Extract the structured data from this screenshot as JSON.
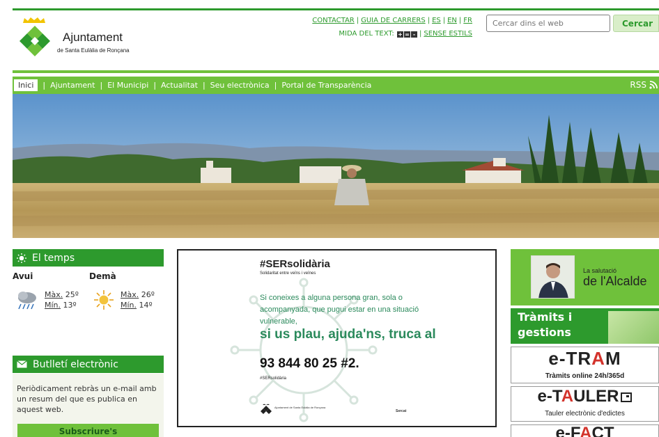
{
  "colors": {
    "brand_green": "#2d9a2d",
    "light_green": "#6fc13b",
    "red": "#d3332c"
  },
  "logo": {
    "title": "Ajuntament",
    "subtitle": "de Santa Eulàlia de Ronçana"
  },
  "toplinks": {
    "contactar": "CONTACTAR",
    "guia": "GUIA DE CARRERS",
    "es": "ES",
    "en": "EN",
    "fr": "FR",
    "text_size": "MIDA DEL TEXT:",
    "text_size_buttons": [
      "+",
      "=",
      "-"
    ],
    "no_styles": "SENSE ESTILS"
  },
  "search": {
    "placeholder": "Cercar dins el web",
    "button": "Cercar"
  },
  "nav": {
    "items": [
      {
        "label": "Inici",
        "active": true
      },
      {
        "label": "Ajuntament"
      },
      {
        "label": "El Municipi"
      },
      {
        "label": "Actualitat"
      },
      {
        "label": "Seu electrònica"
      },
      {
        "label": "Portal de Transparència"
      }
    ],
    "rss": "RSS"
  },
  "weather": {
    "title": "El temps",
    "today": {
      "label": "Avui",
      "max": "Màx.",
      "max_val": " 25º",
      "min": "Mín.",
      "min_val": " 13º",
      "icon": "rain-cloud-icon"
    },
    "tomorrow": {
      "label": "Demà",
      "max": "Màx.",
      "max_val": " 26º",
      "min": "Mín.",
      "min_val": " 14º",
      "icon": "sun-icon"
    }
  },
  "newsletter": {
    "title": "Butlletí electrònic",
    "text": "Periòdicament rebràs un e-mail amb un resum del que es publica en aquest web.",
    "button": "Subscriure's"
  },
  "banner": {
    "title": "#SERsolidària",
    "subtitle": "Solidaritat entre veïns i veïnes",
    "text": "Si coneixes a alguna persona gran, sola o acompanyada, que pugui estar en una situació vulnerable,",
    "call": "si us plau, ajuda'ns, truca al",
    "phone": "93 844 80 25 #2.",
    "hashtag": "#SERsolidària",
    "logo_text": "Ajuntament de Santa Eulàlia de Ronçana",
    "partner": "Sercat"
  },
  "right": {
    "alcalde_small": "La salutació",
    "alcalde_big": "de l'Alcalde",
    "tramits": "Tràmits i gestions",
    "etram_prefix": "e-TR",
    "etram_red": "A",
    "etram_suffix": "M",
    "etram_sub": "Tràmits online 24h/365d",
    "etauler_prefix": "e-T",
    "etauler_red": "A",
    "etauler_suffix": "ULER",
    "etauler_sub": "Tauler electrònic d'edictes",
    "efact_prefix": "e-F",
    "efact_red": "A",
    "efact_suffix": "CT"
  }
}
